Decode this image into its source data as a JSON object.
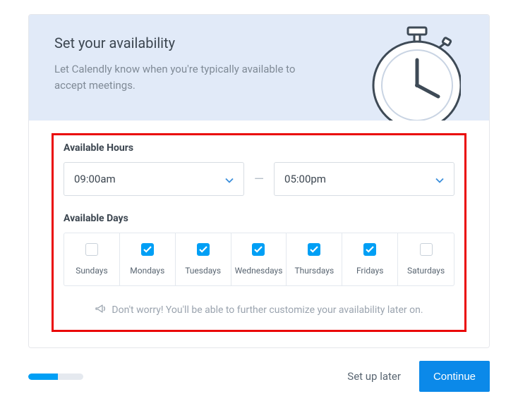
{
  "header": {
    "title": "Set your availability",
    "subtitle": "Let Calendly know when you're typically available to accept meetings."
  },
  "hours": {
    "label": "Available Hours",
    "start": "09:00am",
    "end": "05:00pm"
  },
  "days": {
    "label": "Available Days",
    "items": [
      {
        "label": "Sundays",
        "checked": false
      },
      {
        "label": "Mondays",
        "checked": true
      },
      {
        "label": "Tuesdays",
        "checked": true
      },
      {
        "label": "Wednesdays",
        "checked": true
      },
      {
        "label": "Thursdays",
        "checked": true
      },
      {
        "label": "Fridays",
        "checked": true
      },
      {
        "label": "Saturdays",
        "checked": false
      }
    ]
  },
  "tip": "Don't worry! You'll be able to further customize your availability later on.",
  "footer": {
    "setup_later": "Set up later",
    "continue": "Continue",
    "progress_pct": 54
  },
  "colors": {
    "accent": "#009ff5",
    "primary_button": "#0b89e9",
    "banner_bg": "#e1eaf8",
    "highlight_border": "#ea0707"
  }
}
